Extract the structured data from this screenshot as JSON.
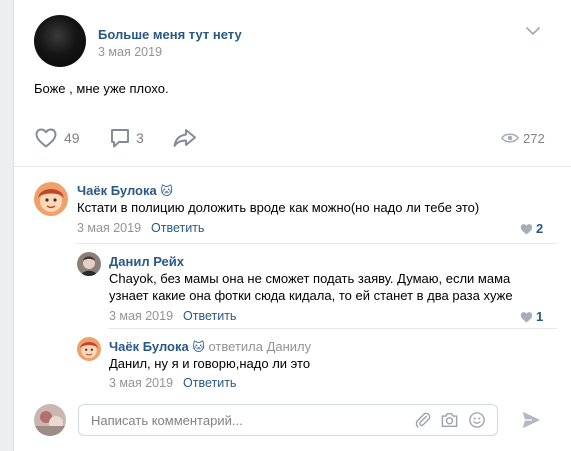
{
  "post": {
    "author": "Больше меня тут нету",
    "date": "3 мая 2019",
    "text": "Боже , мне уже плохо.",
    "likes": "49",
    "comments": "3",
    "views": "272"
  },
  "comments": [
    {
      "author": "Чаёк Булока",
      "emoji": "🐱",
      "text_lines": [
        "Кстати в полицию доложить вроде как можно(но надо ли тебе это)"
      ],
      "date": "3 мая 2019",
      "reply_label": "Ответить",
      "likes": "2"
    },
    {
      "author": "Данил Рейх",
      "text_lines": [
        "Chayok, без мамы она не сможет подать заяву. Думаю, если мама",
        "узнает какие она фотки сюда кидала, то ей станет в два раза хуже"
      ],
      "date": "3 мая 2019",
      "reply_label": "Ответить",
      "likes": "1"
    },
    {
      "author": "Чаёк Булока",
      "emoji": "🐱",
      "addressed": "ответила Данилу",
      "text_lines": [
        "Данил, ну я и говорю,надо ли это"
      ],
      "date": "3 мая 2019",
      "reply_label": "Ответить"
    }
  ],
  "composer": {
    "placeholder": "Написать комментарий..."
  },
  "colors": {
    "link": "#2a5885",
    "muted": "#939393",
    "icon": "#828a99"
  },
  "icons": [
    "chevron-down-icon",
    "heart-icon",
    "comment-icon",
    "share-icon",
    "eye-icon",
    "paperclip-icon",
    "camera-icon",
    "smile-icon",
    "send-icon"
  ]
}
